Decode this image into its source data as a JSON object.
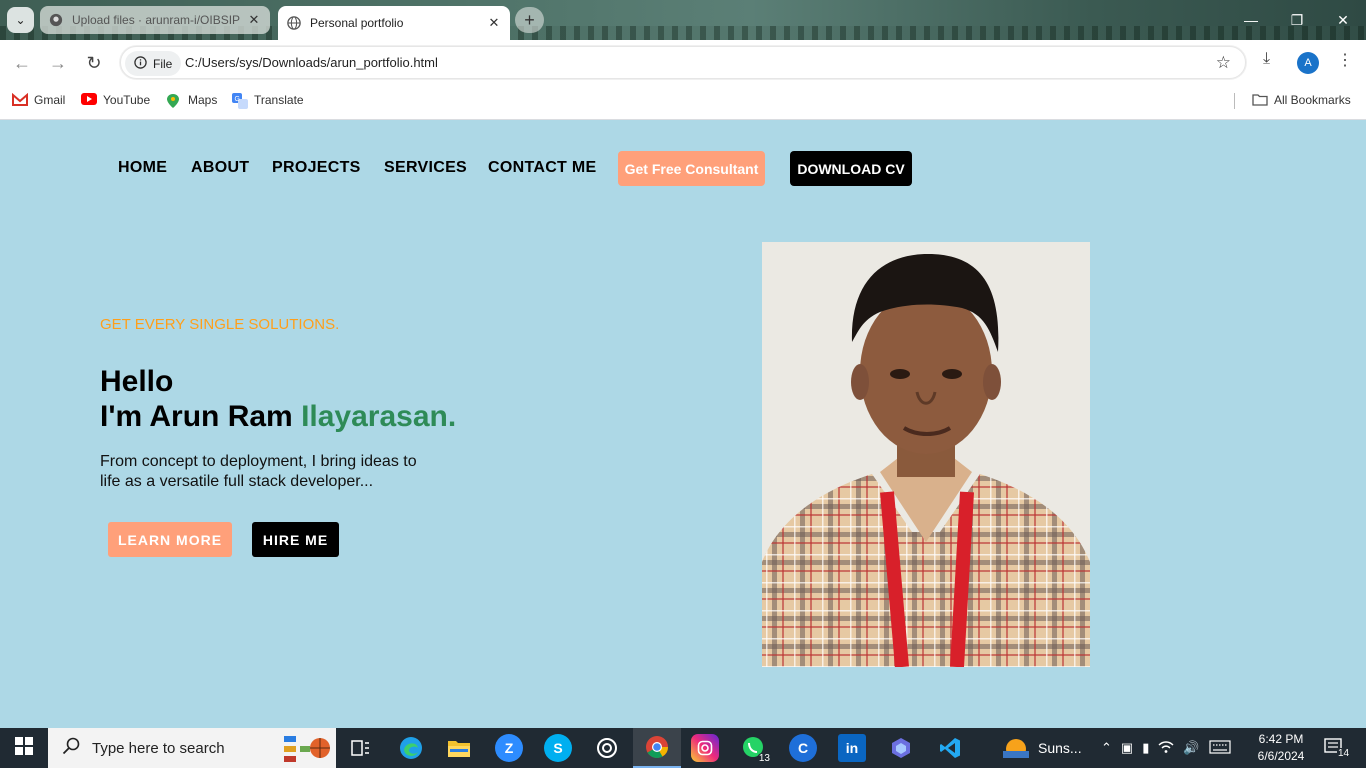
{
  "browser": {
    "tabs": [
      {
        "title": "Upload files · arunram-i/OIBSIP",
        "icon": "github-icon"
      },
      {
        "title": "Personal portfolio",
        "icon": "globe-icon"
      }
    ],
    "address": {
      "chip_label": "File",
      "url": "C:/Users/sys/Downloads/arun_portfolio.html"
    },
    "profile_initial": "A",
    "bookmarks": [
      {
        "label": "Gmail",
        "icon": "gmail-icon"
      },
      {
        "label": "YouTube",
        "icon": "youtube-icon"
      },
      {
        "label": "Maps",
        "icon": "maps-icon"
      },
      {
        "label": "Translate",
        "icon": "translate-icon"
      }
    ],
    "all_bookmarks_label": "All Bookmarks"
  },
  "site": {
    "nav": [
      "HOME",
      "ABOUT",
      "PROJECTS",
      "SERVICES",
      "CONTACT ME"
    ],
    "consult_label": "Get Free Consultant",
    "cv_label": "DOWNLOAD CV",
    "tagline": "GET EVERY SINGLE SOLUTIONS.",
    "hello": "Hello",
    "name_prefix": "I'm Arun Ram ",
    "name_accent": "Ilayarasan.",
    "intro": "From concept to deployment, I bring ideas to life as a versatile full stack developer...",
    "learn_label": "LEARN MORE",
    "hire_label": "HIRE ME",
    "colors": {
      "background": "#add8e6",
      "accent_orange": "#ffa07a",
      "tagline": "#ff9f1a",
      "name_green": "#2e8b57"
    }
  },
  "taskbar": {
    "search_placeholder": "Type here to search",
    "weather_label": "Suns...",
    "whatsapp_badge": "13",
    "time": "6:42 PM",
    "date": "6/6/2024",
    "notifications": "14"
  }
}
